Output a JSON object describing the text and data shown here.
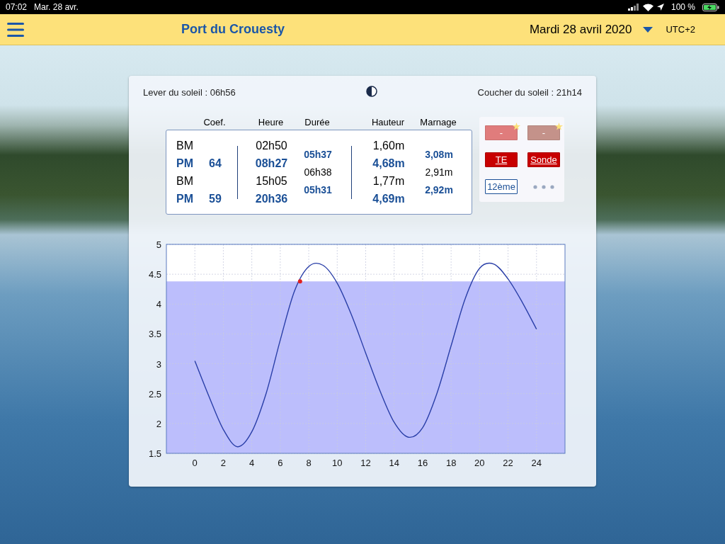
{
  "status_bar": {
    "time": "07:02",
    "date": "Mar. 28 avr.",
    "battery": "100 %"
  },
  "header": {
    "title": "Port du Crouesty",
    "date": "Mardi 28 avril 2020",
    "timezone": "UTC+2"
  },
  "sun": {
    "sunrise": "Lever du soleil : 06h56",
    "sunset": "Coucher du soleil : 21h14"
  },
  "table": {
    "columns": [
      "Coef.",
      "Heure",
      "Durée",
      "Hauteur",
      "Marnage"
    ],
    "tides": [
      {
        "type": "BM",
        "kind": "low",
        "time": "02h50",
        "height": "1,60m"
      },
      {
        "type": "PM",
        "kind": "high",
        "coef": "64",
        "time": "08h27",
        "height": "4,68m"
      },
      {
        "type": "BM",
        "kind": "low",
        "time": "15h05",
        "height": "1,77m"
      },
      {
        "type": "PM",
        "kind": "high",
        "coef": "59",
        "time": "20h36",
        "height": "4,69m"
      }
    ],
    "intervals": [
      {
        "kind": "rising",
        "duration": "05h37",
        "range": "3,08m"
      },
      {
        "kind": "falling",
        "duration": "06h38",
        "range": "2,91m"
      },
      {
        "kind": "rising",
        "duration": "05h31",
        "range": "2,92m"
      }
    ]
  },
  "buttons": [
    {
      "kind": "favorite",
      "label": "-",
      "color": "#e07c7c"
    },
    {
      "kind": "favorite",
      "label": "-",
      "color": "#c4928a"
    },
    {
      "kind": "solid",
      "label": "TE"
    },
    {
      "kind": "solid",
      "label": "Sonde"
    },
    {
      "kind": "outline",
      "label": "12ème"
    },
    {
      "kind": "more"
    }
  ],
  "chart_data": {
    "type": "line",
    "xlim": [
      -2,
      26
    ],
    "ylim": [
      1.5,
      5
    ],
    "xticks": [
      0,
      2,
      4,
      6,
      8,
      10,
      12,
      14,
      16,
      18,
      20,
      22,
      24
    ],
    "yticks": [
      {
        "value": 1.5,
        "label": "1.5"
      },
      {
        "value": 2,
        "label": "2"
      },
      {
        "value": 2.5,
        "label": "2.5"
      },
      {
        "value": 3,
        "label": "3"
      },
      {
        "value": 3.5,
        "label": "3.5"
      },
      {
        "value": 4,
        "label": "4"
      },
      {
        "value": 4.5,
        "label": "4.5"
      },
      {
        "value": 5,
        "label": "5"
      }
    ],
    "x": [
      0,
      1,
      2,
      3,
      4,
      5,
      6,
      7,
      8,
      9,
      10,
      11,
      12,
      13,
      14,
      15,
      16,
      17,
      18,
      19,
      20,
      21,
      22,
      23,
      24
    ],
    "series": [
      {
        "color": "#2a3fa8",
        "values": [
          3.05,
          2.45,
          1.9,
          1.61,
          1.86,
          2.5,
          3.4,
          4.22,
          4.63,
          4.65,
          4.35,
          3.82,
          3.18,
          2.55,
          2.02,
          1.77,
          1.93,
          2.5,
          3.3,
          4.1,
          4.6,
          4.67,
          4.42,
          4.03,
          3.58
        ]
      }
    ],
    "grid": true,
    "bands": [
      {
        "axis": "y",
        "from": 1.5,
        "to": 4.38,
        "color": "#bcbefc"
      }
    ]
  }
}
